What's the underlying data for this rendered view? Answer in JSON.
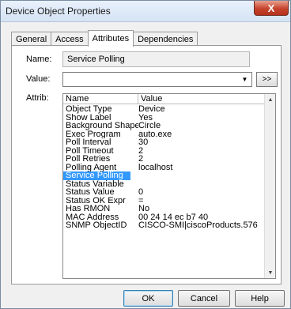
{
  "window": {
    "title": "Device Object Properties",
    "close_label": "X"
  },
  "tabs": [
    {
      "label": "General",
      "active": false
    },
    {
      "label": "Access",
      "active": false
    },
    {
      "label": "Attributes",
      "active": true
    },
    {
      "label": "Dependencies",
      "active": false
    }
  ],
  "fields": {
    "name_label": "Name:",
    "name_value": "Service Polling",
    "value_label": "Value:",
    "value_value": "",
    "more_button": ">>",
    "attrib_label": "Attrib:"
  },
  "attributes": {
    "columns": [
      "Name",
      "Value"
    ],
    "selected_index": 8,
    "rows": [
      {
        "name": "Object Type",
        "value": "Device"
      },
      {
        "name": "Show Label",
        "value": "Yes"
      },
      {
        "name": "Background Shape",
        "value": "Circle"
      },
      {
        "name": "Exec Program",
        "value": "auto.exe"
      },
      {
        "name": "Poll Interval",
        "value": "30"
      },
      {
        "name": "Poll Timeout",
        "value": "2"
      },
      {
        "name": "Poll Retries",
        "value": "2"
      },
      {
        "name": "Polling Agent",
        "value": "localhost"
      },
      {
        "name": "Service Polling",
        "value": ""
      },
      {
        "name": "Status Variable",
        "value": ""
      },
      {
        "name": "Status Value",
        "value": "0"
      },
      {
        "name": "Status OK Expr",
        "value": "="
      },
      {
        "name": "Has RMON",
        "value": "No"
      },
      {
        "name": "MAC Address",
        "value": "00 24 14 ec b7 40"
      },
      {
        "name": "SNMP ObjectID",
        "value": "CISCO-SMI|ciscoProducts.576"
      }
    ]
  },
  "buttons": {
    "ok": "OK",
    "cancel": "Cancel",
    "help": "Help"
  }
}
